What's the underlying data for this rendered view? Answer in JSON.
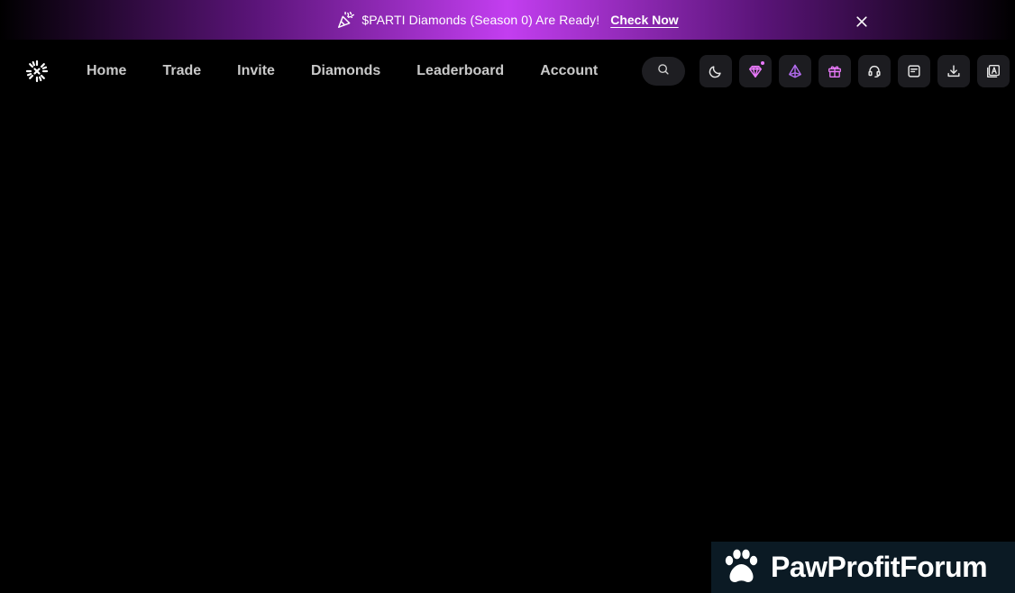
{
  "banner": {
    "message": "$PARTI Diamonds (Season 0) Are Ready!",
    "cta": "Check Now",
    "party_icon": "party-popper-icon",
    "close_icon": "close-icon"
  },
  "navbar": {
    "logo_icon": "particle-logo-icon",
    "links": [
      "Home",
      "Trade",
      "Invite",
      "Diamonds",
      "Leaderboard",
      "Account"
    ],
    "search_icon": "search-icon",
    "icon_buttons": [
      "moon-icon",
      "diamond-icon",
      "crystal-icon",
      "gift-icon",
      "headset-icon",
      "notes-icon",
      "download-icon",
      "translate-icon"
    ]
  },
  "watermark": {
    "text": "PawProfitForum",
    "icon": "paw-icon"
  },
  "colors": {
    "background": "#000000",
    "banner_accent": "#c33ef0",
    "diamond_accent": "#e879f9",
    "crystal_accent": "#b46cf0",
    "nav_text": "#c9c9c9",
    "button_bg": "#1c1c20"
  }
}
